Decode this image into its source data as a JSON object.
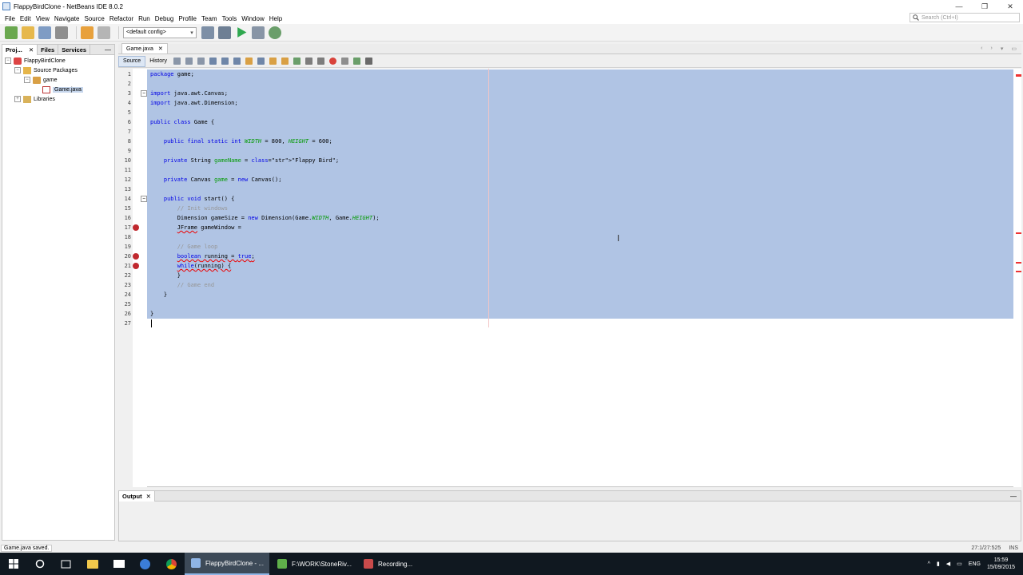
{
  "window": {
    "title": "FlappyBirdClone - NetBeans IDE 8.0.2",
    "min": "—",
    "restore": "❐",
    "close": "✕"
  },
  "menu": [
    "File",
    "Edit",
    "View",
    "Navigate",
    "Source",
    "Refactor",
    "Run",
    "Debug",
    "Profile",
    "Team",
    "Tools",
    "Window",
    "Help"
  ],
  "search": {
    "placeholder": "Search (Ctrl+I)"
  },
  "toolbar": {
    "config": "<default config>"
  },
  "left_panel": {
    "tabs": [
      "Proj...",
      "Files",
      "Services"
    ],
    "close_glyph": "✕",
    "minimize": "—",
    "tree": [
      {
        "label": "FlappyBirdClone",
        "depth": 0,
        "icon": "project-icon"
      },
      {
        "label": "Source Packages",
        "depth": 1,
        "icon": "source-packages-icon"
      },
      {
        "label": "game",
        "depth": 2,
        "icon": "package-icon"
      },
      {
        "label": "Game.java",
        "depth": 3,
        "icon": "java-file-icon"
      },
      {
        "label": "Libraries",
        "depth": 1,
        "icon": "libraries-icon"
      }
    ]
  },
  "editor": {
    "tab": "Game.java",
    "tab_close": "✕",
    "mode_source": "Source",
    "mode_history": "History",
    "nav_prev": "‹",
    "nav_next": "›",
    "nav_list": "▾",
    "maximize": "▭"
  },
  "code": [
    "package game;",
    "",
    "import java.awt.Canvas;",
    "import java.awt.Dimension;",
    "",
    "public class Game {",
    "",
    "    public final static int WIDTH = 800, HEIGHT = 600;",
    "",
    "    private String gameName = \"Flappy Bird\";",
    "",
    "    private Canvas game = new Canvas();",
    "",
    "    public void start() {",
    "        // Init windows",
    "        Dimension gameSize = new Dimension(Game.WIDTH, Game.HEIGHT);",
    "        JFrame gameWindow =",
    "",
    "        // Game loop",
    "        boolean running = true;",
    "        while(running) {",
    "        }",
    "        // Game end",
    "    }",
    "",
    "}",
    ""
  ],
  "output": {
    "tab": "Output",
    "close": "✕",
    "minimize": "—"
  },
  "status": {
    "message": "Game.java saved.",
    "position": "27:1/27:525",
    "mode": "INS"
  },
  "taskbar": {
    "apps": [
      "FlappyBirdClone - ...",
      "F:\\WORK\\StoneRiv...",
      "Recording..."
    ],
    "lang": "ENG",
    "time": "15:59",
    "date": "15/09/2015"
  },
  "colors": {
    "selection": "#b0c4e4",
    "keyword": "#0000e6",
    "field": "#009900",
    "string": "#ce7b00",
    "comment": "#969696",
    "error": "#c0282e"
  }
}
